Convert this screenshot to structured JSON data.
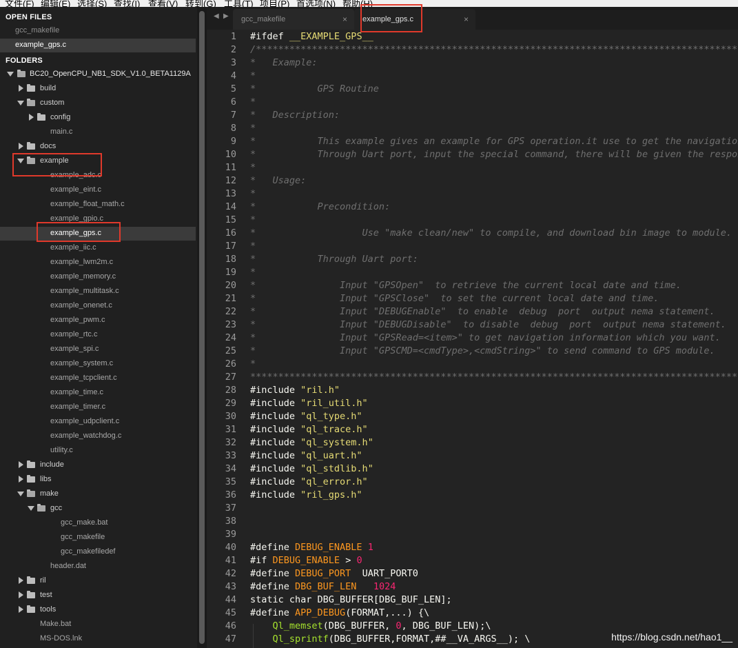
{
  "menu": [
    "文件(F)",
    "编辑(E)",
    "选择(S)",
    "查找(I)",
    "查看(V)",
    "转到(G)",
    "工具(T)",
    "项目(P)",
    "首选项(N)",
    "帮助(H)"
  ],
  "sidebar": {
    "open_files_header": "OPEN FILES",
    "open_files": [
      {
        "label": "gcc_makefile",
        "selected": false
      },
      {
        "label": "example_gps.c",
        "selected": true
      }
    ],
    "folders_header": "FOLDERS",
    "tree": [
      {
        "label": "BC20_OpenCPU_NB1_SDK_V1.0_BETA1129A",
        "type": "folder",
        "expanded": true,
        "depth": 0
      },
      {
        "label": "build",
        "type": "folder",
        "expanded": false,
        "depth": 1
      },
      {
        "label": "custom",
        "type": "folder",
        "expanded": true,
        "depth": 1
      },
      {
        "label": "config",
        "type": "folder",
        "expanded": false,
        "depth": 2
      },
      {
        "label": "main.c",
        "type": "file",
        "depth": 2
      },
      {
        "label": "docs",
        "type": "folder",
        "expanded": false,
        "depth": 1
      },
      {
        "label": "example",
        "type": "folder",
        "expanded": true,
        "depth": 1
      },
      {
        "label": "example_adc.c",
        "type": "file",
        "depth": 2
      },
      {
        "label": "example_eint.c",
        "type": "file",
        "depth": 2
      },
      {
        "label": "example_float_math.c",
        "type": "file",
        "depth": 2
      },
      {
        "label": "example_gpio.c",
        "type": "file",
        "depth": 2
      },
      {
        "label": "example_gps.c",
        "type": "file",
        "depth": 2,
        "selected": true
      },
      {
        "label": "example_iic.c",
        "type": "file",
        "depth": 2
      },
      {
        "label": "example_lwm2m.c",
        "type": "file",
        "depth": 2
      },
      {
        "label": "example_memory.c",
        "type": "file",
        "depth": 2
      },
      {
        "label": "example_multitask.c",
        "type": "file",
        "depth": 2
      },
      {
        "label": "example_onenet.c",
        "type": "file",
        "depth": 2
      },
      {
        "label": "example_pwm.c",
        "type": "file",
        "depth": 2
      },
      {
        "label": "example_rtc.c",
        "type": "file",
        "depth": 2
      },
      {
        "label": "example_spi.c",
        "type": "file",
        "depth": 2
      },
      {
        "label": "example_system.c",
        "type": "file",
        "depth": 2
      },
      {
        "label": "example_tcpclient.c",
        "type": "file",
        "depth": 2
      },
      {
        "label": "example_time.c",
        "type": "file",
        "depth": 2
      },
      {
        "label": "example_timer.c",
        "type": "file",
        "depth": 2
      },
      {
        "label": "example_udpclient.c",
        "type": "file",
        "depth": 2
      },
      {
        "label": "example_watchdog.c",
        "type": "file",
        "depth": 2
      },
      {
        "label": "utility.c",
        "type": "file",
        "depth": 2
      },
      {
        "label": "include",
        "type": "folder",
        "expanded": false,
        "depth": 1
      },
      {
        "label": "libs",
        "type": "folder",
        "expanded": false,
        "depth": 1
      },
      {
        "label": "make",
        "type": "folder",
        "expanded": true,
        "depth": 1
      },
      {
        "label": "gcc",
        "type": "folder",
        "expanded": true,
        "depth": 2
      },
      {
        "label": "gcc_make.bat",
        "type": "file",
        "depth": 3
      },
      {
        "label": "gcc_makefile",
        "type": "file",
        "depth": 3
      },
      {
        "label": "gcc_makefiledef",
        "type": "file",
        "depth": 3
      },
      {
        "label": "header.dat",
        "type": "file",
        "depth": 2
      },
      {
        "label": "ril",
        "type": "folder",
        "expanded": false,
        "depth": 1
      },
      {
        "label": "test",
        "type": "folder",
        "expanded": false,
        "depth": 1
      },
      {
        "label": "tools",
        "type": "folder",
        "expanded": false,
        "depth": 1
      },
      {
        "label": "Make.bat",
        "type": "file",
        "depth": 1
      },
      {
        "label": "MS-DOS.lnk",
        "type": "file",
        "depth": 1
      }
    ]
  },
  "tabs": {
    "nav_left": "◀",
    "nav_right": "▶",
    "items": [
      {
        "label": "gcc_makefile",
        "active": false,
        "close": "×"
      },
      {
        "label": "example_gps.c",
        "active": true,
        "close": "×"
      }
    ]
  },
  "editor": {
    "lines": [
      {
        "n": "1",
        "segs": [
          [
            "pp",
            "#ifdef "
          ],
          [
            "id",
            "__EXAMPLE_GPS__"
          ]
        ]
      },
      {
        "n": "2",
        "segs": [
          [
            "cmt",
            "/***************************************************************************************************"
          ]
        ]
      },
      {
        "n": "3",
        "segs": [
          [
            "cmt",
            "*   Example:"
          ]
        ]
      },
      {
        "n": "4",
        "segs": [
          [
            "cmt",
            "*"
          ]
        ]
      },
      {
        "n": "5",
        "segs": [
          [
            "cmt",
            "*           GPS Routine"
          ]
        ]
      },
      {
        "n": "6",
        "segs": [
          [
            "cmt",
            "*"
          ]
        ]
      },
      {
        "n": "7",
        "segs": [
          [
            "cmt",
            "*   Description:"
          ]
        ]
      },
      {
        "n": "8",
        "segs": [
          [
            "cmt",
            "*"
          ]
        ]
      },
      {
        "n": "9",
        "segs": [
          [
            "cmt",
            "*           This example gives an example for GPS operation.it use to get the navigation"
          ]
        ]
      },
      {
        "n": "10",
        "segs": [
          [
            "cmt",
            "*           Through Uart port, input the special command, there will be given the response"
          ]
        ]
      },
      {
        "n": "11",
        "segs": [
          [
            "cmt",
            "*"
          ]
        ]
      },
      {
        "n": "12",
        "segs": [
          [
            "cmt",
            "*   Usage:"
          ]
        ]
      },
      {
        "n": "13",
        "segs": [
          [
            "cmt",
            "*"
          ]
        ]
      },
      {
        "n": "14",
        "segs": [
          [
            "cmt",
            "*           Precondition:"
          ]
        ]
      },
      {
        "n": "15",
        "segs": [
          [
            "cmt",
            "*"
          ]
        ]
      },
      {
        "n": "16",
        "segs": [
          [
            "cmt",
            "*                   Use \"make clean/new\" to compile, and download bin image to module."
          ]
        ]
      },
      {
        "n": "17",
        "segs": [
          [
            "cmt",
            "*"
          ]
        ]
      },
      {
        "n": "18",
        "segs": [
          [
            "cmt",
            "*           Through Uart port:"
          ]
        ]
      },
      {
        "n": "19",
        "segs": [
          [
            "cmt",
            "*"
          ]
        ]
      },
      {
        "n": "20",
        "segs": [
          [
            "cmt",
            "*               Input \"GPSOpen\"  to retrieve the current local date and time."
          ]
        ]
      },
      {
        "n": "21",
        "segs": [
          [
            "cmt",
            "*               Input \"GPSClose\"  to set the current local date and time."
          ]
        ]
      },
      {
        "n": "22",
        "segs": [
          [
            "cmt",
            "*               Input \"DEBUGEnable\"  to enable  debug  port  output nema statement."
          ]
        ]
      },
      {
        "n": "23",
        "segs": [
          [
            "cmt",
            "*               Input \"DEBUGDisable\"  to disable  debug  port  output nema statement."
          ]
        ]
      },
      {
        "n": "24",
        "segs": [
          [
            "cmt",
            "*               Input \"GPSRead=<item>\" to get navigation information which you want."
          ]
        ]
      },
      {
        "n": "25",
        "segs": [
          [
            "cmt",
            "*               Input \"GPSCMD=<cmdType>,<cmdString>\" to send command to GPS module."
          ]
        ]
      },
      {
        "n": "26",
        "segs": [
          [
            "cmt",
            "*"
          ]
        ]
      },
      {
        "n": "27",
        "segs": [
          [
            "cmt",
            "****************************************************************************************************/"
          ]
        ]
      },
      {
        "n": "28",
        "segs": [
          [
            "pp",
            "#include "
          ],
          [
            "str",
            "\"ril.h\""
          ]
        ]
      },
      {
        "n": "29",
        "segs": [
          [
            "pp",
            "#include "
          ],
          [
            "str",
            "\"ril_util.h\""
          ]
        ]
      },
      {
        "n": "30",
        "segs": [
          [
            "pp",
            "#include "
          ],
          [
            "str",
            "\"ql_type.h\""
          ]
        ]
      },
      {
        "n": "31",
        "segs": [
          [
            "pp",
            "#include "
          ],
          [
            "str",
            "\"ql_trace.h\""
          ]
        ]
      },
      {
        "n": "32",
        "segs": [
          [
            "pp",
            "#include "
          ],
          [
            "str",
            "\"ql_system.h\""
          ]
        ]
      },
      {
        "n": "33",
        "segs": [
          [
            "pp",
            "#include "
          ],
          [
            "str",
            "\"ql_uart.h\""
          ]
        ]
      },
      {
        "n": "34",
        "segs": [
          [
            "pp",
            "#include "
          ],
          [
            "str",
            "\"ql_stdlib.h\""
          ]
        ]
      },
      {
        "n": "35",
        "segs": [
          [
            "pp",
            "#include "
          ],
          [
            "str",
            "\"ql_error.h\""
          ]
        ]
      },
      {
        "n": "36",
        "segs": [
          [
            "pp",
            "#include "
          ],
          [
            "str",
            "\"ril_gps.h\""
          ]
        ]
      },
      {
        "n": "37",
        "segs": []
      },
      {
        "n": "38",
        "segs": []
      },
      {
        "n": "39",
        "segs": []
      },
      {
        "n": "40",
        "segs": [
          [
            "pp",
            "#define "
          ],
          [
            "const",
            "DEBUG_ENABLE"
          ],
          [
            "pp",
            " "
          ],
          [
            "num",
            "1"
          ]
        ]
      },
      {
        "n": "41",
        "segs": [
          [
            "pp",
            "#if "
          ],
          [
            "const",
            "DEBUG_ENABLE"
          ],
          [
            "pp",
            " > "
          ],
          [
            "num",
            "0"
          ]
        ]
      },
      {
        "n": "42",
        "segs": [
          [
            "pp",
            "#define "
          ],
          [
            "const",
            "DEBUG_PORT"
          ],
          [
            "pp",
            "  UART_PORT0"
          ]
        ]
      },
      {
        "n": "43",
        "segs": [
          [
            "pp",
            "#define "
          ],
          [
            "const",
            "DBG_BUF_LEN"
          ],
          [
            "pp",
            "   "
          ],
          [
            "numo",
            "1024"
          ]
        ]
      },
      {
        "n": "44",
        "segs": [
          [
            "kw",
            "static char "
          ],
          [
            "pp",
            "DBG_BUFFER[DBG_BUF_LEN];"
          ]
        ]
      },
      {
        "n": "45",
        "segs": [
          [
            "pp",
            "#define "
          ],
          [
            "const",
            "APP_DEBUG"
          ],
          [
            "pp",
            "(FORMAT,...) {\\"
          ]
        ]
      },
      {
        "n": "46",
        "segs": [
          [
            "pp",
            "    "
          ],
          [
            "fn",
            "Ql_memset"
          ],
          [
            "pp",
            "(DBG_BUFFER, "
          ],
          [
            "num",
            "0"
          ],
          [
            "pp",
            ", DBG_BUF_LEN);\\"
          ]
        ]
      },
      {
        "n": "47",
        "segs": [
          [
            "pp",
            "    "
          ],
          [
            "fn",
            "Ql_sprintf"
          ],
          [
            "pp",
            "(DBG_BUFFER,FORMAT,##__VA_ARGS__); \\"
          ]
        ]
      }
    ]
  },
  "watermark": "https://blog.csdn.net/hao1__"
}
